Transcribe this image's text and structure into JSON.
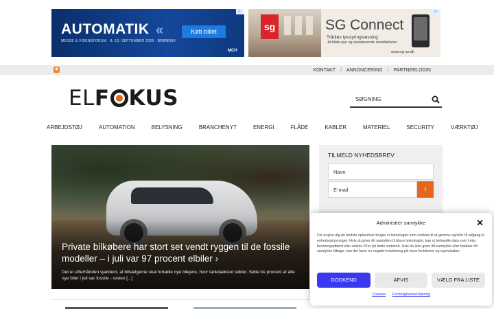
{
  "ads": {
    "automatik": {
      "title": "AUTOMATIK",
      "chevrons": "«",
      "subtitle": "MESSE & VIDENSFORUM · 8.-10. SEPTEMBER 2026 · BRØNDBY",
      "button": "Køb billet",
      "brand": "MCH"
    },
    "sg": {
      "logo": "sg",
      "name": "SG Connect",
      "line1": "Trådløs lysstyringsløsning",
      "line2": "-til både nye og eksisterende installationer",
      "url": "www.sg-as.dk"
    },
    "info_icon": "ad-choices-icon"
  },
  "topbar": {
    "rss_icon": "rss-icon",
    "links": [
      "KONTAKT",
      "ANNONCERING",
      "PARTNERLOGIN"
    ],
    "separator": "/"
  },
  "header": {
    "logo_left": "EL",
    "logo_right": "KUS",
    "logo_f": "F",
    "search_placeholder": "SØGNING"
  },
  "nav": {
    "items": [
      "ARBEJDSTØJ",
      "AUTOMATION",
      "BELYSNING",
      "BRANCHENYT",
      "ENERGI",
      "FLÅDE",
      "KABLER",
      "MATERIEL",
      "SECURITY",
      "VÆRKTØJ"
    ]
  },
  "hero": {
    "headline": "Private bilkøbere har stort set vendt ryggen til de fossile modeller – i juli var 97 procent elbiler",
    "arrow": "›",
    "excerpt": "Det er efterhånden sjældent, at bilsælgerne skal fortælle nye bilejere, hvor tankdækslet sidder. Sølle tre procent af alle nye biler i juli var fossile - resten",
    "more": "[...]"
  },
  "newsletter": {
    "title": "TILMELD NYHEDSBREV",
    "name_placeholder": "Navn",
    "email_placeholder": "E-mail",
    "submit": "›"
  },
  "cookie": {
    "title": "Administrer samtykke",
    "close": "✕",
    "body": "For at give dig de bedste oplevelser bruger vi teknologier som cookies til at gemme og/eller få adgang til enhedsoplysninger. Hvis du giver dit samtykke til disse teknologier, kan vi behandle data som f.eks. browsingadfærd eller unikke ID'er på dette websted. Hvis du ikke giver dit samtykke eller trækker dit samtykke tilbage, kan det have en negativ indvirkning på visse funktioner og egenskaber.",
    "accept": "GODKEND",
    "deny": "AFVIS",
    "prefs": "VÆLG FRA LISTE",
    "link_cookies": "Cookies",
    "link_privacy": "Fortrolighedserklæring"
  },
  "colors": {
    "accent": "#e5671f",
    "cookie_primary": "#3b39ef"
  }
}
